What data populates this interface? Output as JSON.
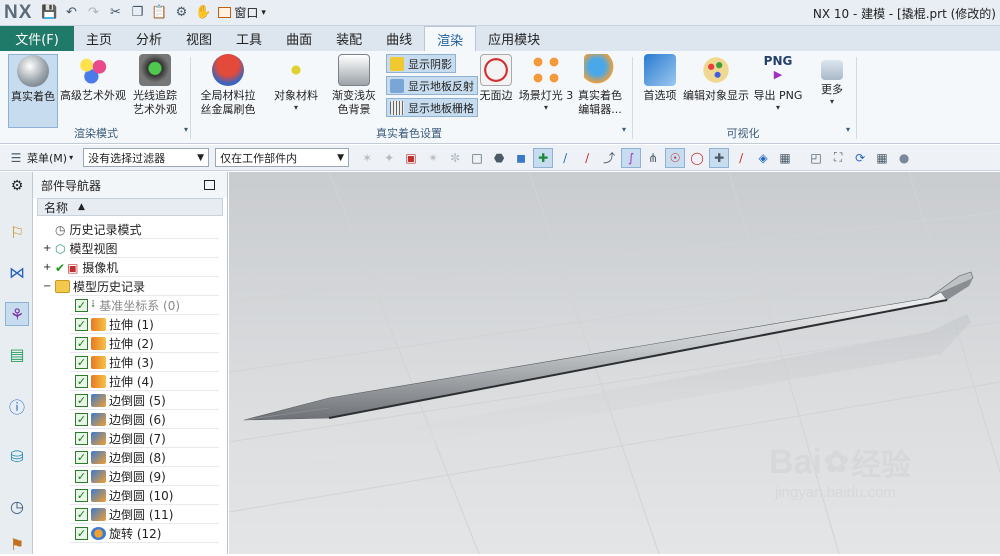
{
  "app": {
    "logo": "NX",
    "title": "NX 10 - 建模 - [撬棍.prt  (修改的)",
    "window_menu": "窗口"
  },
  "tabs": {
    "file": "文件(F)",
    "items": [
      "主页",
      "分析",
      "视图",
      "工具",
      "曲面",
      "装配",
      "曲线",
      "渲染",
      "应用模块"
    ],
    "active": "渲染"
  },
  "ribbon": {
    "render_mode": {
      "true_shading": "真实着色",
      "advanced_studio_1": "高级艺术外观",
      "advanced_studio_2": "",
      "raytrace_1": "光线追踪",
      "raytrace_2": "艺术外观",
      "group_label": "渲染模式"
    },
    "shading_settings": {
      "global_material_1": "全局材料拉",
      "global_material_2": "丝金属刷色",
      "object_material": "对象材料",
      "gradient_bg_1": "渐变浅灰",
      "gradient_bg_2": "色背景",
      "show_shadow": "显示阴影",
      "show_floor_reflection": "显示地板反射",
      "show_floor_grid": "显示地板栅格",
      "no_edges": "无面边",
      "scene_lights": "场景灯光 3",
      "shading_editor_1": "真实着色",
      "shading_editor_2": "编辑器...",
      "group_label": "真实着色设置"
    },
    "visualization": {
      "preferences": "首选项",
      "edit_object_display": "编辑对象显示",
      "export_png": "导出 PNG",
      "png_label": "PNG",
      "more": "更多",
      "group_label": "可视化"
    }
  },
  "toolbar": {
    "menu": "菜单(M)",
    "filter": "没有选择过滤器",
    "scope": "仅在工作部件内"
  },
  "navigator": {
    "title": "部件导航器",
    "column_name": "名称",
    "items": [
      {
        "label": "历史记录模式"
      },
      {
        "label": "模型视图"
      },
      {
        "label": "摄像机"
      },
      {
        "label": "模型历史记录"
      },
      {
        "label": "基准坐标系 (0)"
      },
      {
        "label": "拉伸 (1)"
      },
      {
        "label": "拉伸 (2)"
      },
      {
        "label": "拉伸 (3)"
      },
      {
        "label": "拉伸 (4)"
      },
      {
        "label": "边倒圆 (5)"
      },
      {
        "label": "边倒圆 (6)"
      },
      {
        "label": "边倒圆 (7)"
      },
      {
        "label": "边倒圆 (8)"
      },
      {
        "label": "边倒圆 (9)"
      },
      {
        "label": "边倒圆 (10)"
      },
      {
        "label": "边倒圆 (11)"
      },
      {
        "label": "旋转 (12)"
      }
    ]
  },
  "watermark": {
    "brand": "Bai",
    "brand_cn": "经验",
    "url": "jingyan.baidu.com"
  }
}
